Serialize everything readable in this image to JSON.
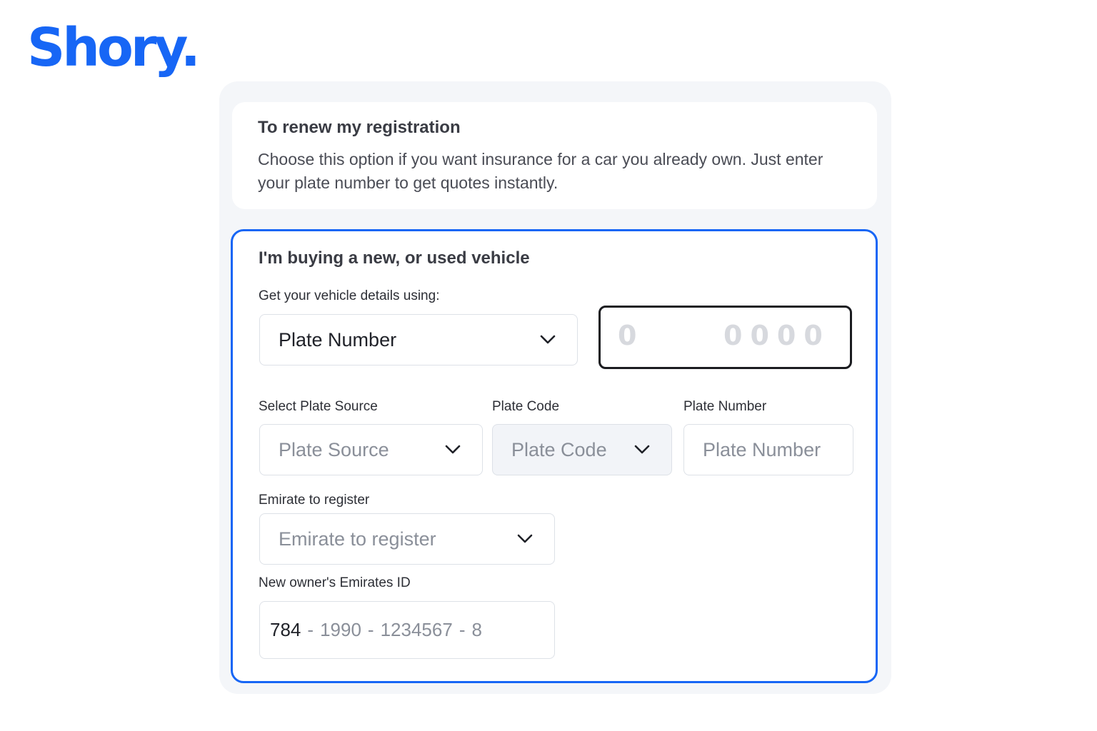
{
  "brand": {
    "logo_text": "Shory.",
    "color": "#1766f5"
  },
  "renew_option": {
    "title": "To renew my registration",
    "description": "Choose this option if you want insurance for a car you already own. Just enter your plate number to get quotes instantly."
  },
  "buy_option": {
    "title": "I'm buying a new, or used vehicle",
    "details_label": "Get your vehicle details using:",
    "details_method": {
      "value": "Plate Number",
      "icon": "chevron-down-icon"
    },
    "plate_preview": {
      "code": "0",
      "number": "0000"
    },
    "plate_source": {
      "label": "Select Plate Source",
      "placeholder": "Plate Source",
      "icon": "chevron-down-icon"
    },
    "plate_code": {
      "label": "Plate Code",
      "placeholder": "Plate Code",
      "icon": "chevron-down-icon"
    },
    "plate_number": {
      "label": "Plate Number",
      "placeholder": "Plate Number"
    },
    "emirate": {
      "label": "Emirate to register",
      "placeholder": "Emirate to register",
      "icon": "chevron-down-icon"
    },
    "emirates_id": {
      "label": "New owner's Emirates ID",
      "prefix": "784",
      "separator": "-",
      "part_year": "1990",
      "part_serial": "1234567",
      "part_check": "8"
    }
  }
}
